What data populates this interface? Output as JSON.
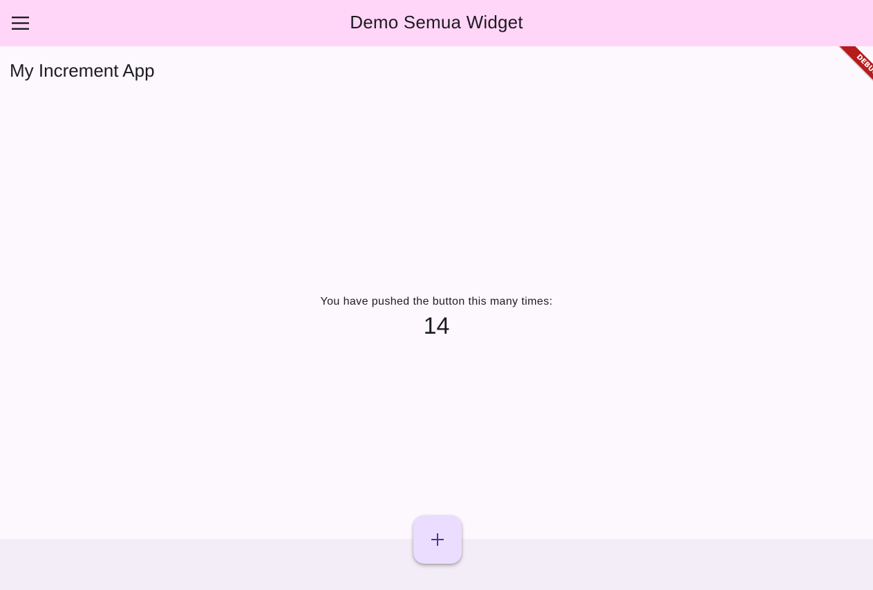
{
  "app_bar": {
    "title": "Demo Semua Widget",
    "menu_icon": "menu-icon"
  },
  "page": {
    "heading": "My Increment App",
    "counter_caption": "You have pushed the button this many times:",
    "counter_value": "14"
  },
  "fab": {
    "icon": "plus-icon"
  },
  "debug_banner": {
    "label": "DEBUG"
  },
  "colors": {
    "app_bar_bg": "#ffd6f8",
    "body_bg": "#fdf7fe",
    "bottom_bg": "#f3edf7",
    "fab_bg": "#eaddff",
    "fab_icon": "#4f378b",
    "debug_banner": "#b71c1c",
    "text": "#1d1b20"
  }
}
